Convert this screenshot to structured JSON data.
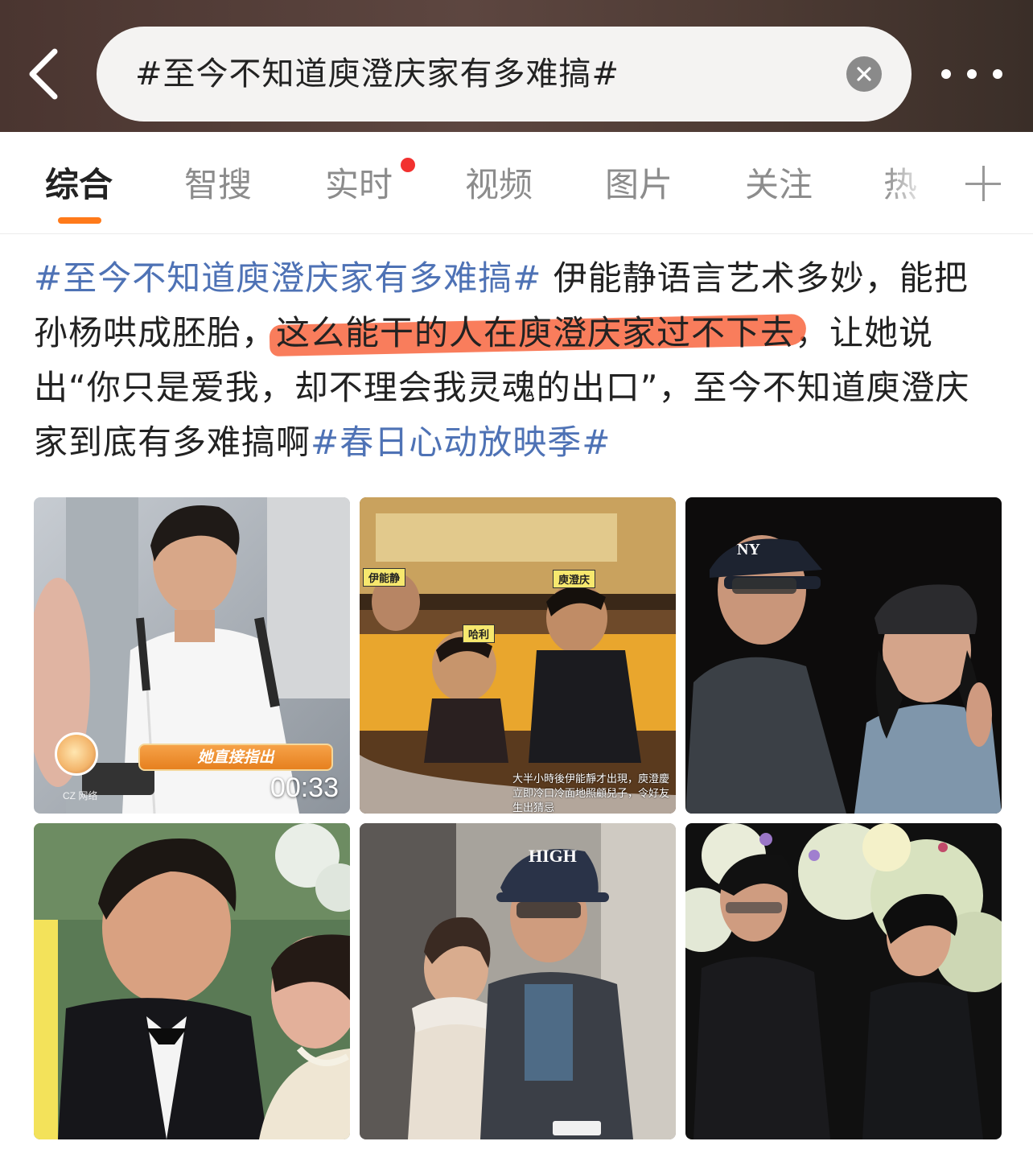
{
  "header": {
    "search_query": "#至今不知道庾澄庆家有多难搞#",
    "back_icon": "chevron-left-icon",
    "clear_icon": "clear-circle-icon",
    "more_icon": "more-dots-icon"
  },
  "tabs": {
    "items": [
      {
        "label": "综合",
        "active": true
      },
      {
        "label": "智搜"
      },
      {
        "label": "实时",
        "badge": "red-dot"
      },
      {
        "label": "视频"
      },
      {
        "label": "图片"
      },
      {
        "label": "关注"
      },
      {
        "label": "热"
      }
    ],
    "accent_color": "#ff7a1a"
  },
  "post": {
    "topic_1": "#至今不知道庾澄庆家有多难搞#",
    "text_1": " 伊能静语言艺术多妙，能把孙杨哄成胚胎，",
    "highlighted": "这么能干的人在庾澄庆家过不下去",
    "text_2": "，让她说出“你只是爱我，却不理会我灵魂的出口”，至今不知道庾澄庆家到底有多难搞啊",
    "topic_2": "#春日心动放映季#",
    "topic_color": "#4e72b5",
    "highlight_color": "#f86038"
  },
  "images": {
    "video_duration": "00:33",
    "video_caption": "她直接指出",
    "video_watermark": "CZ 网络",
    "photo2_label_1": "伊能静",
    "photo2_label_2": "庾澄庆",
    "photo2_label_3": "哈利",
    "photo2_caption": "大半小時後伊能靜才出現，庾澄慶立即冷口冷面地照顧兒子，令好友生出猜忌",
    "photo3_cap_text": "NY",
    "photo5_cap_text": "HIGH"
  }
}
